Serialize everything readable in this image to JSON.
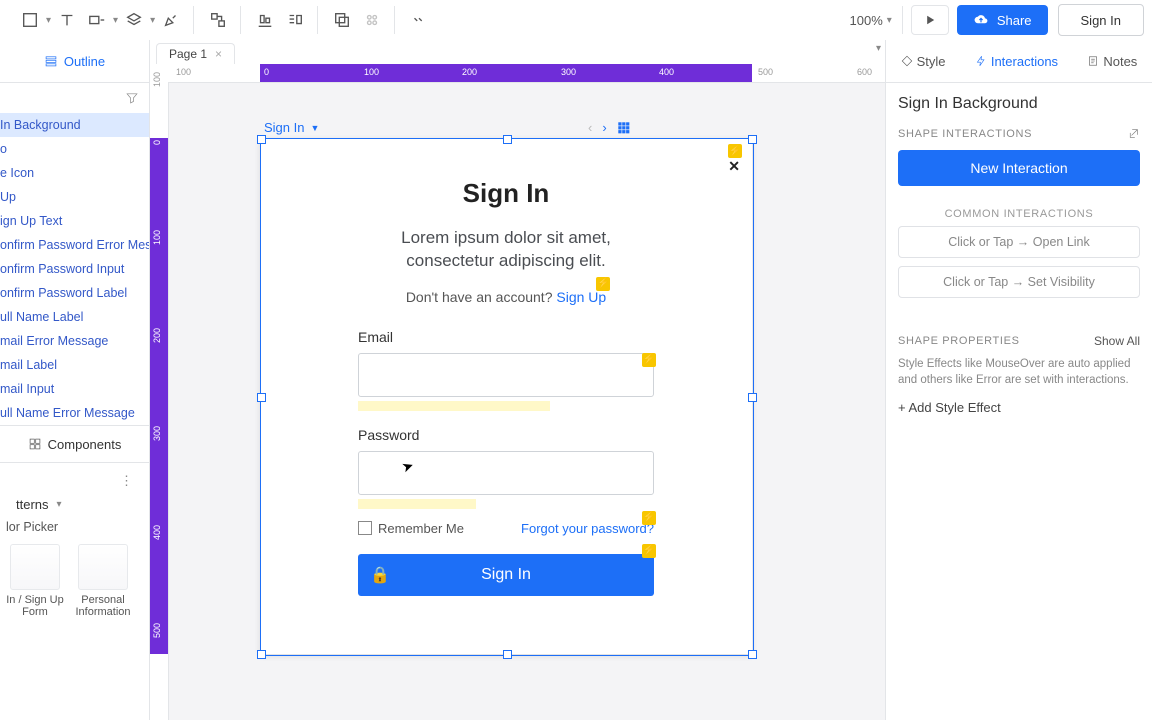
{
  "toolbar": {
    "zoom": "100%",
    "share": "Share",
    "signin": "Sign In"
  },
  "leftPanel": {
    "outlineTab": "Outline",
    "tree": [
      "In Background",
      "o",
      "e Icon",
      " Up",
      "ign Up Text",
      "onfirm Password Error Mes",
      "onfirm Password Input",
      "onfirm Password Label",
      "ull Name Label",
      "mail Error Message",
      "mail Label",
      "mail Input",
      "ull Name Error Message"
    ],
    "componentsHead": "Components",
    "library": "tterns",
    "libItem": "lor Picker",
    "thumbs": [
      "In / Sign Up Form",
      "Personal Information"
    ]
  },
  "tabs": {
    "page1": "Page 1"
  },
  "canvas": {
    "artboardLabel": "Sign In",
    "form": {
      "title": "Sign In",
      "subtitle1": "Lorem ipsum dolor sit amet,",
      "subtitle2": "consectetur adipiscing elit.",
      "hint": "Don't have an account?  ",
      "signup": "Sign Up",
      "emailLabel": "Email",
      "passwordLabel": "Password",
      "remember": "Remember Me",
      "forgot": "Forgot your password?",
      "button": "Sign In"
    }
  },
  "rightPanel": {
    "tabs": {
      "style": "Style",
      "interactions": "Interactions",
      "notes": "Notes"
    },
    "selectionName": "Sign In Background",
    "shapeInteractions": "SHAPE INTERACTIONS",
    "newInteraction": "New Interaction",
    "commonHead": "COMMON INTERACTIONS",
    "common1": "Click or Tap → Open Link",
    "common2": "Click or Tap → Set Visibility",
    "propsHead": "SHAPE PROPERTIES",
    "showAll": "Show All",
    "note": "Style Effects like MouseOver are auto applied and others like Error are set with interactions.",
    "addEffect": "+ Add Style Effect"
  },
  "ruler": {
    "top": [
      "100",
      "0",
      "100",
      "200",
      "300",
      "400",
      "500",
      "600"
    ],
    "left": [
      "100",
      "0",
      "100",
      "200",
      "300",
      "400",
      "500"
    ]
  }
}
